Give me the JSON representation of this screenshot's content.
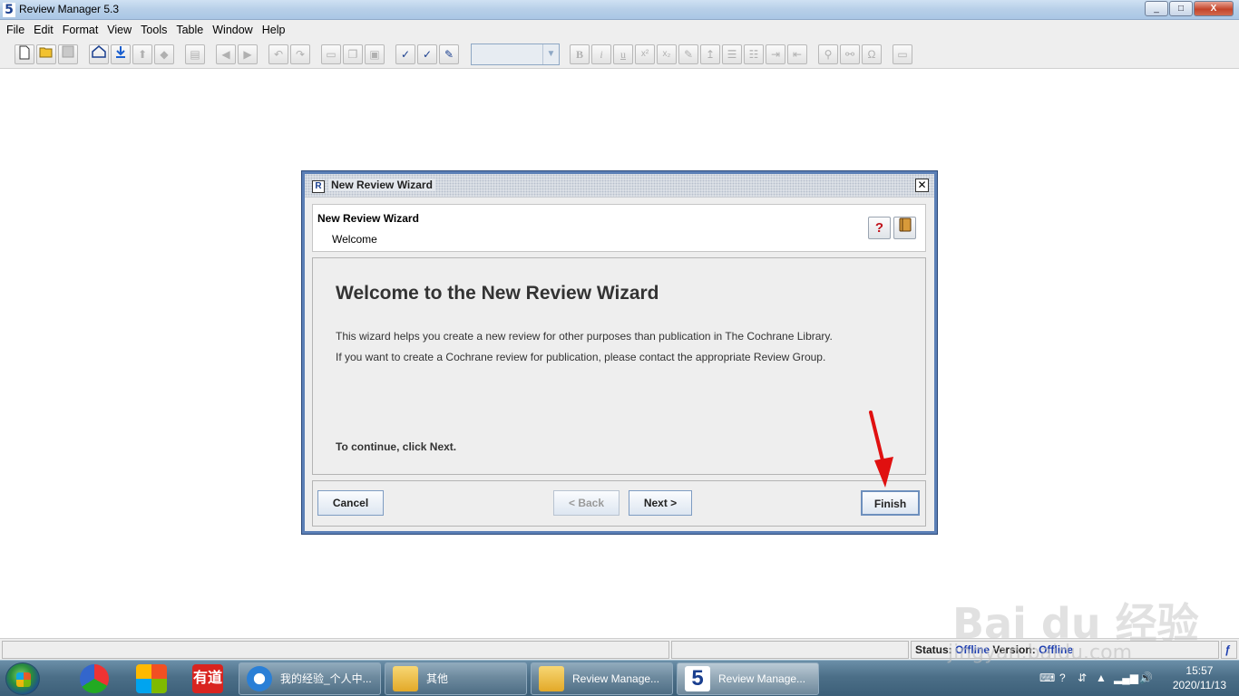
{
  "window": {
    "title": "Review Manager 5.3",
    "app_icon_char": "5",
    "controls": {
      "minimize": "_",
      "maximize": "□",
      "close": "X"
    }
  },
  "menu": {
    "items": [
      {
        "label": "File",
        "mnemonic": "F"
      },
      {
        "label": "Edit",
        "mnemonic": "E"
      },
      {
        "label": "Format",
        "mnemonic": "F"
      },
      {
        "label": "View",
        "mnemonic": "V"
      },
      {
        "label": "Tools",
        "mnemonic": "T"
      },
      {
        "label": "Table",
        "mnemonic": "T"
      },
      {
        "label": "Window",
        "mnemonic": "W"
      },
      {
        "label": "Help",
        "mnemonic": "H"
      }
    ]
  },
  "toolbar": {
    "bold": "B",
    "italic": "i",
    "underline": "u",
    "superscript": "x²",
    "subscript": "x₂",
    "omega": "Ω",
    "font_combo_value": ""
  },
  "dialog": {
    "title": "New Review Wizard",
    "header_title": "New Review Wizard",
    "header_subtitle": "Welcome",
    "help_glyph": "?",
    "heading": "Welcome to the New Review Wizard",
    "paragraph1": "This wizard helps you create a new review for other purposes than publication in The Cochrane Library.",
    "paragraph2": "If you want to create a Cochrane review for publication, please contact the appropriate Review Group.",
    "continue_text": "To continue, click Next.",
    "buttons": {
      "cancel": "Cancel",
      "back": "< Back",
      "next": "Next >",
      "finish": "Finish"
    }
  },
  "statusbar": {
    "status_label": "Status:",
    "status_value": "Offline",
    "version_label": "Version:",
    "version_value": "Offline"
  },
  "taskbar": {
    "tasks": [
      {
        "label": "我的经验_个人中..."
      },
      {
        "label": "其他"
      },
      {
        "label": "Review Manage..."
      },
      {
        "label": "Review Manage..."
      }
    ],
    "quick_launch_youdao": "有道",
    "clock_time": "15:57",
    "clock_date": "2020/11/13"
  },
  "watermark": {
    "brand": "Bai du 经验",
    "url": "jingyan.baidu.com"
  },
  "colors": {
    "dialog_border": "#5b7fb6",
    "status_value": "#1e3fb0",
    "arrow": "#e01010"
  }
}
